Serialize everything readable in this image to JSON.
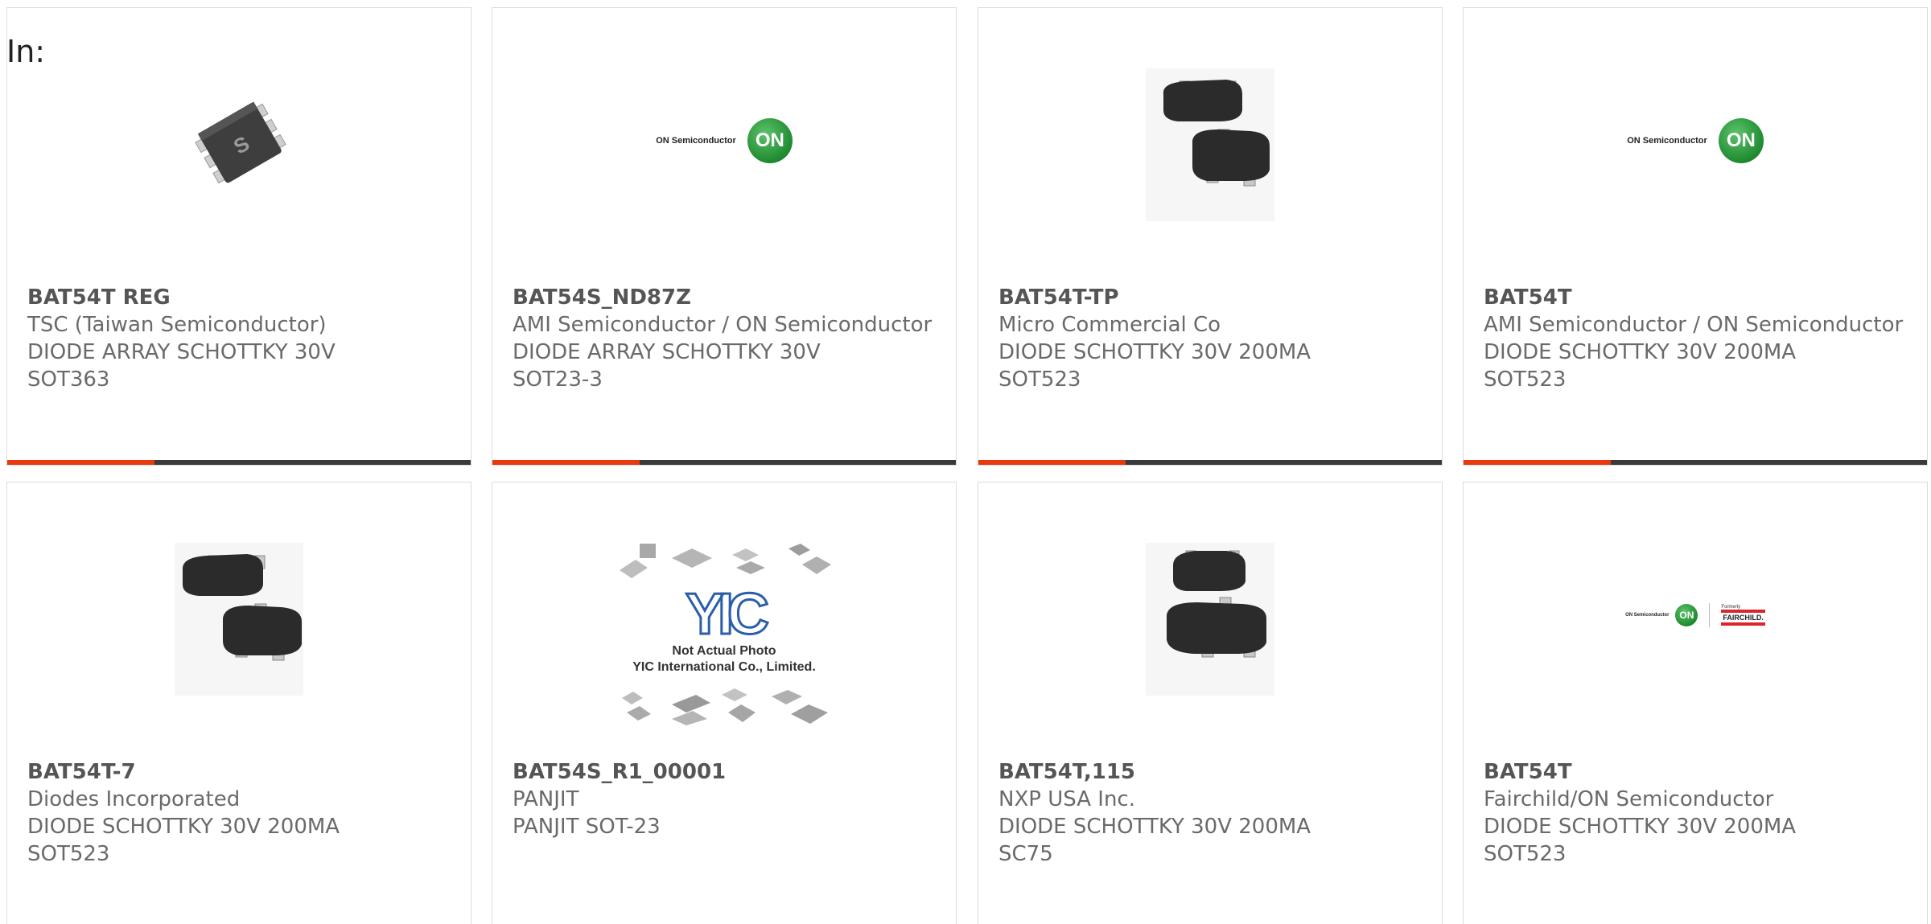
{
  "page": {
    "in_label": "In:"
  },
  "colors": {
    "accent": "#e8380d",
    "bar": "#3a3a3a",
    "on_green": "#1f8a30"
  },
  "cards": [
    {
      "part": "BAT54T REG",
      "manufacturer": "TSC (Taiwan Semiconductor)",
      "description": "DIODE ARRAY SCHOTTKY 30V",
      "package": "SOT363",
      "image": "sot363-chip-icon"
    },
    {
      "part": "BAT54S_ND87Z",
      "manufacturer": "AMI Semiconductor / ON Semiconductor",
      "description": "DIODE ARRAY SCHOTTKY 30V",
      "package": "SOT23-3",
      "image": "on-semiconductor-logo",
      "logo_text": "ON Semiconductor",
      "logo_mark": "ON"
    },
    {
      "part": "BAT54T-TP",
      "manufacturer": "Micro Commercial Co",
      "description": "DIODE SCHOTTKY 30V 200MA",
      "package": "SOT523",
      "image": "sot523-chip-icon"
    },
    {
      "part": "BAT54T",
      "manufacturer": "AMI Semiconductor / ON Semiconductor",
      "description": "DIODE SCHOTTKY 30V 200MA",
      "package": "SOT523",
      "image": "on-semiconductor-logo",
      "logo_text": "ON Semiconductor",
      "logo_mark": "ON"
    },
    {
      "part": "BAT54T-7",
      "manufacturer": "Diodes Incorporated",
      "description": "DIODE SCHOTTKY 30V 200MA",
      "package": "SOT523",
      "image": "sot523-chip-icon"
    },
    {
      "part": "BAT54S_R1_00001",
      "manufacturer": "PANJIT",
      "description": "PANJIT SOT-23",
      "package": "",
      "image": "yic-placeholder",
      "logo_mark": "YIC",
      "note_line1": "Not Actual Photo",
      "note_line2": "YIC International Co., Limited."
    },
    {
      "part": "BAT54T,115",
      "manufacturer": "NXP USA Inc.",
      "description": "DIODE SCHOTTKY 30V 200MA",
      "package": "SC75",
      "image": "sot523-chip-icon"
    },
    {
      "part": "BAT54T",
      "manufacturer": "Fairchild/ON Semiconductor",
      "description": "DIODE SCHOTTKY 30V 200MA",
      "package": "SOT523",
      "image": "on-fairchild-logo",
      "logo_text": "ON Semiconductor",
      "logo_mark": "ON",
      "logo2_small": "Formerly",
      "logo2_text": "FAIRCHILD."
    }
  ]
}
